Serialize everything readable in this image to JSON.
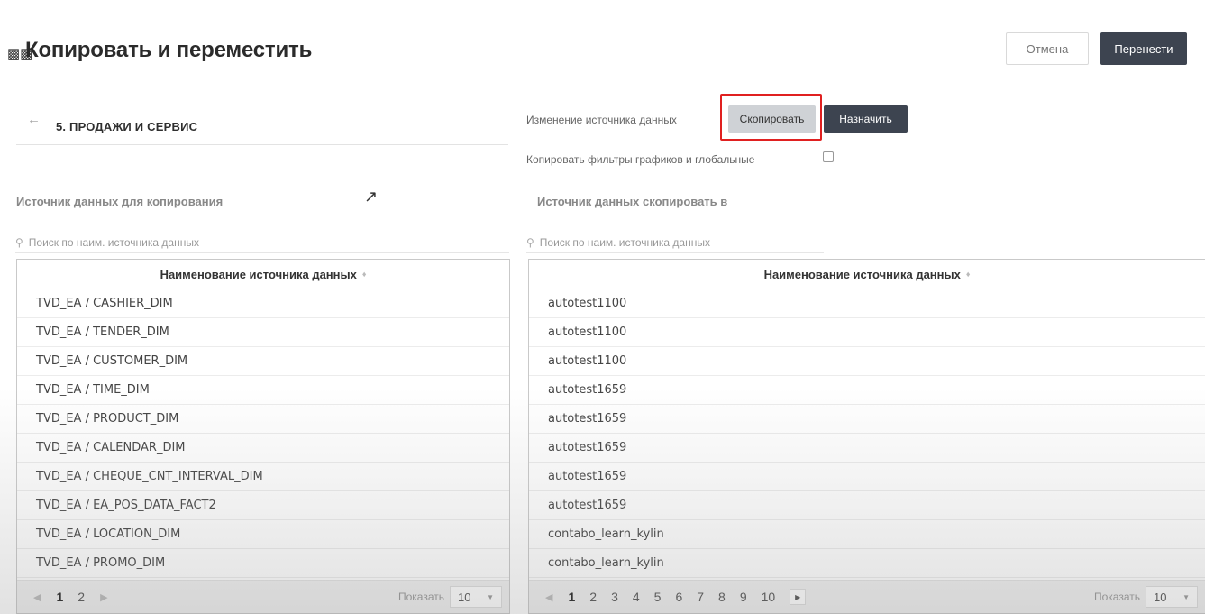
{
  "header": {
    "title": "Копировать и переместить",
    "cancel_label": "Отмена",
    "move_label": "Перенести"
  },
  "left": {
    "back_label": "5. ПРОДАЖИ И СЕРВИС",
    "section_label": "Источник данных для копирования",
    "search_placeholder": "Поиск по наим. источника данных",
    "column_header": "Наименование источника данных",
    "rows": [
      "TVD_EA / CASHIER_DIM",
      "TVD_EA / TENDER_DIM",
      "TVD_EA / CUSTOMER_DIM",
      "TVD_EA / TIME_DIM",
      "TVD_EA / PRODUCT_DIM",
      "TVD_EA / CALENDAR_DIM",
      "TVD_EA / CHEQUE_CNT_INTERVAL_DIM",
      "TVD_EA / EA_POS_DATA_FACT2",
      "TVD_EA / LOCATION_DIM",
      "TVD_EA / PROMO_DIM"
    ],
    "pages": [
      "1",
      "2"
    ],
    "active_page": "1",
    "show_label": "Показать",
    "show_value": "10"
  },
  "right": {
    "change_source_label": "Изменение источника данных",
    "copy_label": "Скопировать",
    "assign_label": "Назначить",
    "copy_filters_label": "Копировать фильтры графиков и глобальные",
    "section_label": "Источник данных скопировать в",
    "search_placeholder": "Поиск по наим. источника данных",
    "column_header": "Наименование источника данных",
    "rows": [
      "autotest1100",
      "autotest1100",
      "autotest1100",
      "autotest1659",
      "autotest1659",
      "autotest1659",
      "autotest1659",
      "autotest1659",
      "contabo_learn_kylin",
      "contabo_learn_kylin"
    ],
    "pages": [
      "1",
      "2",
      "3",
      "4",
      "5",
      "6",
      "7",
      "8",
      "9",
      "10"
    ],
    "active_page": "1",
    "show_label": "Показать",
    "show_value": "10"
  },
  "colors": {
    "dark_button": "#3d4450",
    "highlight": "#e02020",
    "copy_button": "#cfd2d6"
  }
}
